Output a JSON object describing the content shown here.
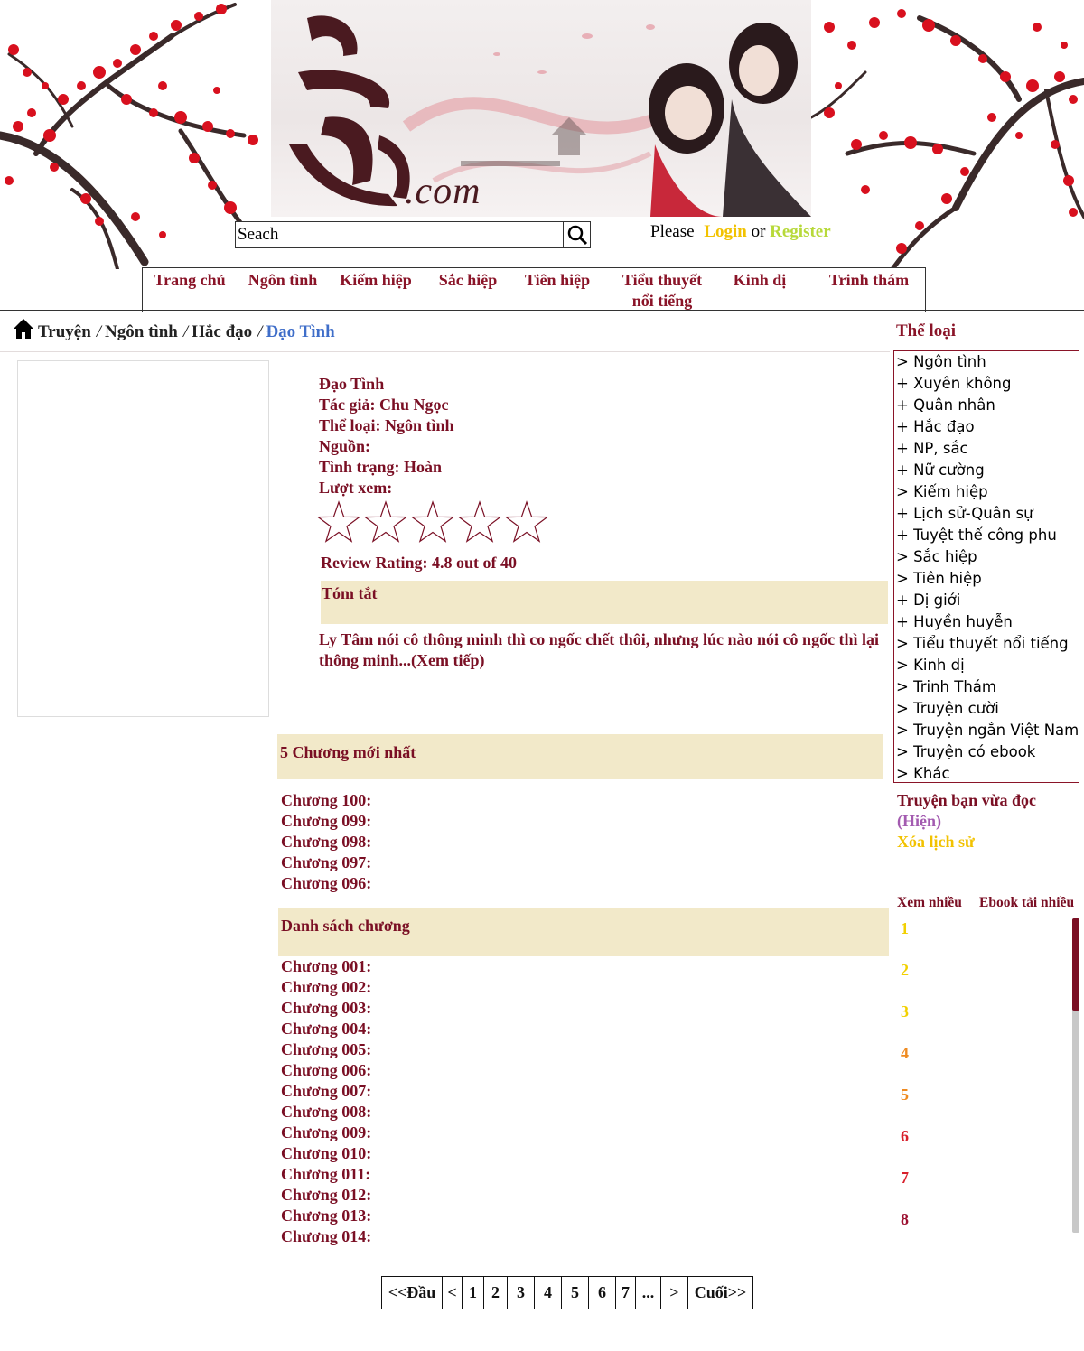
{
  "header": {
    "banner_domain": ".com",
    "search": {
      "placeholder": "Seach",
      "value": ""
    },
    "auth": {
      "prefix": "Please",
      "login": "Login",
      "connector": "or",
      "register": "Register"
    },
    "colors": {
      "login": "#f2c200",
      "register": "#b7d93a"
    }
  },
  "nav": {
    "items": [
      {
        "label": "Trang chủ"
      },
      {
        "label": "Ngôn tình"
      },
      {
        "label": "Kiếm hiệp"
      },
      {
        "label": "Sắc hiệp"
      },
      {
        "label": "Tiên hiệp"
      },
      {
        "label": "Tiểu thuyết nổi tiếng"
      },
      {
        "label": "Kinh dị"
      },
      {
        "label": "Trinh thám"
      }
    ]
  },
  "breadcrumb": {
    "items": [
      "Truyện",
      "Ngôn tình",
      "Hắc đạo"
    ],
    "current": "Đạo Tình",
    "separator": "/"
  },
  "story": {
    "title": "Đạo Tình",
    "author": "Tác giả: Chu Ngọc",
    "genre": "Thể loại: Ngôn tình",
    "source": "Nguồn:",
    "status": "Tình trạng: Hoàn",
    "views": "Lượt xem:",
    "rating_text": "Review Rating: 4.8 out of 40",
    "stars_filled": 0,
    "stars_total": 5,
    "summary_heading": "Tóm tắt",
    "summary": "Ly Tâm nói cô thông minh thì co ngốc chết thôi, nhưng lúc nào nói cô ngốc thì lại thông  minh...(Xem tiếp)"
  },
  "latest": {
    "heading": "5 Chương mới nhất",
    "chapters": [
      "Chương 100:",
      "Chương 099:",
      "Chương 098:",
      "Chương 097:",
      "Chương 096:"
    ]
  },
  "chapters": {
    "heading": "Danh sách chương",
    "items": [
      "Chương 001:",
      "Chương 002:",
      "Chương 003:",
      "Chương 004:",
      "Chương 005:",
      "Chương 006:",
      "Chương 007:",
      "Chương 008:",
      "Chương 009:",
      "Chương 010:",
      "Chương 011:",
      "Chương 012:",
      "Chương 013:",
      "Chương 014:"
    ]
  },
  "pagination": {
    "items": [
      "<<Đầu",
      "<",
      "1",
      "2",
      "3",
      "4",
      "5",
      "6",
      "7",
      "...",
      ">",
      "Cuối>>"
    ]
  },
  "sidebar": {
    "genre_heading": "Thể loại",
    "genres": [
      "> Ngôn tình",
      "+ Xuyên không",
      "+ Quân nhân",
      "+ Hắc đạo",
      "+ NP, sắc",
      "+ Nữ cường",
      "> Kiếm hiệp",
      "+ Lịch sử-Quân sự",
      "+ Tuyệt thế công phu",
      "> Sắc hiệp",
      "> Tiên hiệp",
      "+ Dị giới",
      "+ Huyền huyễn",
      "> Tiểu thuyết nổi tiếng",
      "> Kinh dị",
      "> Trinh Thám",
      "> Truyện cười",
      "> Truyện ngắn Việt Nam",
      "> Truyện có ebook",
      "> Khác"
    ],
    "history_heading": "Truyện bạn vừa đọc",
    "history_current": "(Hiện)",
    "history_clear": "Xóa lịch sử",
    "tabs": [
      "Xem nhiều",
      "Ebook tải nhiều"
    ],
    "ranks": [
      {
        "n": "1",
        "color": "#f2d000"
      },
      {
        "n": "2",
        "color": "#f2d000"
      },
      {
        "n": "3",
        "color": "#f2d000"
      },
      {
        "n": "4",
        "color": "#ef8a1f"
      },
      {
        "n": "5",
        "color": "#ef8a1f"
      },
      {
        "n": "6",
        "color": "#d8202c"
      },
      {
        "n": "7",
        "color": "#d8202c"
      },
      {
        "n": "8",
        "color": "#9c1030"
      }
    ]
  }
}
